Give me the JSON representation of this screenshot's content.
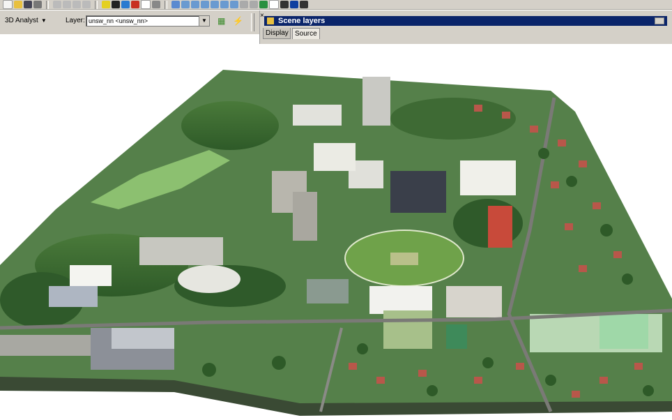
{
  "toolbar": {
    "analyst_label": "3D Analyst",
    "layer_label": "Layer:",
    "layer_value": "unsw_nn <unsw_nn>"
  },
  "panel": {
    "title": "Scene layers",
    "tabs": [
      "Display",
      "Source"
    ]
  },
  "colors": {
    "toolbar_bg": "#d4d0c8",
    "title_bar": "#0a246a"
  }
}
